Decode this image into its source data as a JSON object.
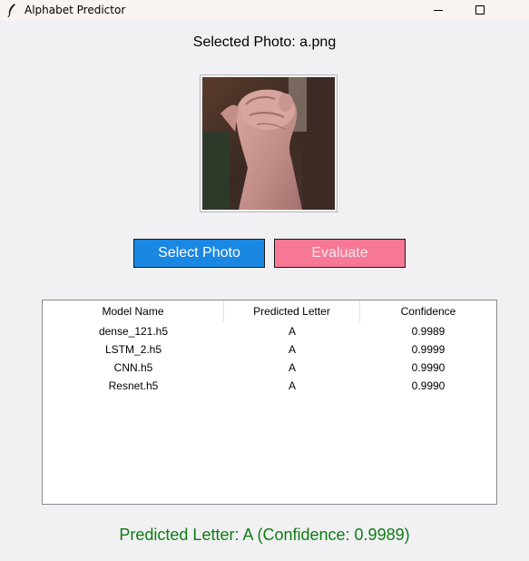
{
  "window": {
    "title": "Alphabet Predictor",
    "icon": "feather-icon"
  },
  "selected_photo": {
    "label": "Selected Photo: a.png"
  },
  "buttons": {
    "select_label": "Select Photo",
    "evaluate_label": "Evaluate",
    "select_color": "#1a87e2",
    "evaluate_color": "#f77895"
  },
  "table": {
    "headers": [
      "Model Name",
      "Predicted Letter",
      "Confidence"
    ],
    "rows": [
      [
        "dense_121.h5",
        "A",
        "0.9989"
      ],
      [
        "LSTM_2.h5",
        "A",
        "0.9999"
      ],
      [
        "CNN.h5",
        "A",
        "0.9990"
      ],
      [
        "Resnet.h5",
        "A",
        "0.9990"
      ]
    ]
  },
  "result": {
    "text": "Predicted Letter: A (Confidence: 0.9989)",
    "color": "#0e7d12"
  }
}
